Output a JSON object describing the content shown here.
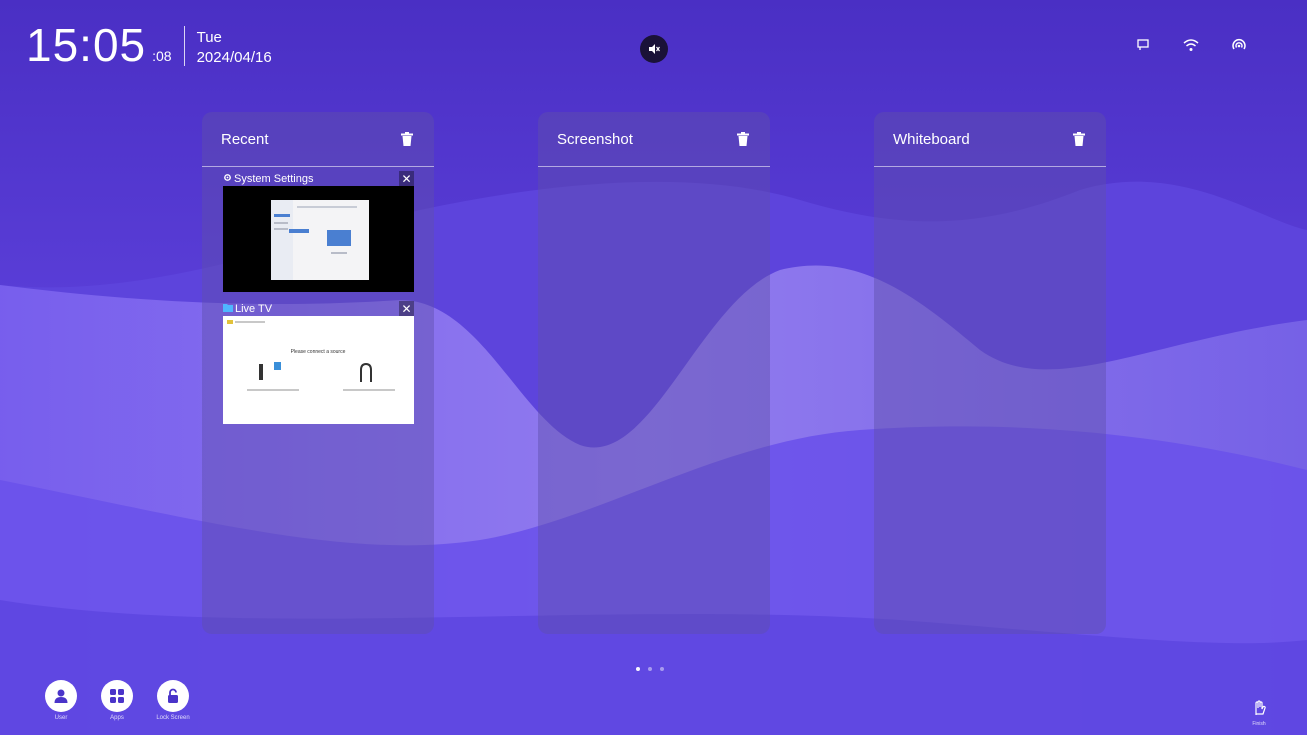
{
  "status_bar": {
    "time": "15:05",
    "seconds": ":08",
    "weekday": "Tue",
    "date": "2024/04/16",
    "icons": [
      "screen-cast-icon",
      "wifi-icon",
      "hotspot-icon"
    ],
    "mute_icon": "speaker-muted-icon"
  },
  "panels": [
    {
      "title": "Recent"
    },
    {
      "title": "Screenshot"
    },
    {
      "title": "Whiteboard"
    }
  ],
  "recent_cards": [
    {
      "title": "System Settings",
      "icon": "settings-icon"
    },
    {
      "title": "Live TV",
      "icon": "folder-icon",
      "screen_text": "Please connect a source"
    }
  ],
  "pager": {
    "pages": 3,
    "current": 1
  },
  "dock": [
    {
      "label": "User",
      "icon": "user-icon"
    },
    {
      "label": "Apps",
      "icon": "apps-grid-icon"
    },
    {
      "label": "Lock Screen",
      "icon": "lock-icon"
    }
  ],
  "corner": {
    "label": "Finish",
    "icon": "hand-icon"
  },
  "colors": {
    "background": "#5a3fd6",
    "panel": "#5f50aa",
    "accent": "#4a7fd1"
  }
}
